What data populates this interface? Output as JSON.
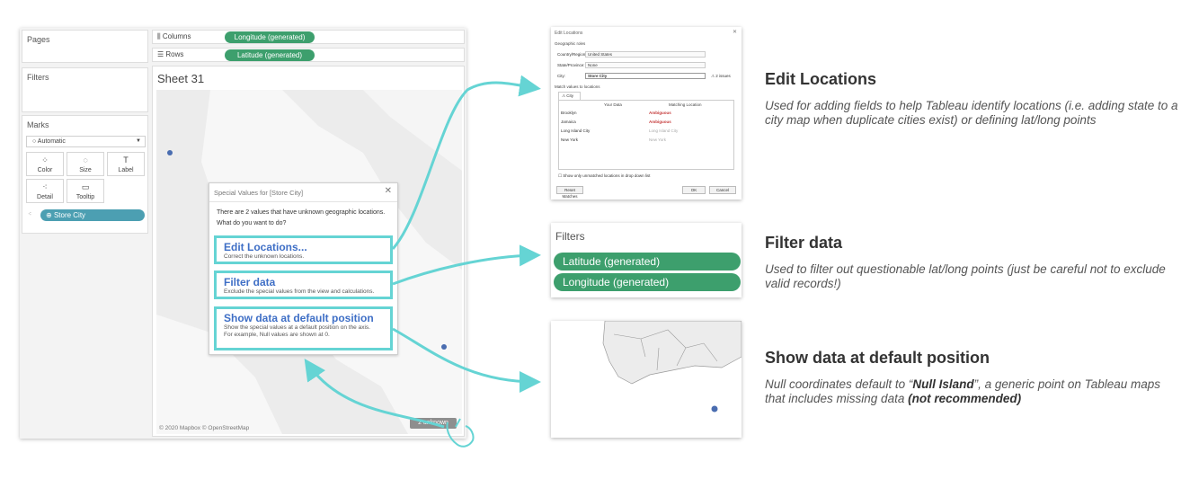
{
  "tableau": {
    "pages_label": "Pages",
    "filters_label": "Filters",
    "marks_label": "Marks",
    "mark_type": "Automatic",
    "mark_buttons": [
      {
        "icon": "color-icon",
        "glyph": "⁘",
        "label": "Color"
      },
      {
        "icon": "size-icon",
        "glyph": "◌",
        "label": "Size"
      },
      {
        "icon": "label-icon",
        "glyph": "T",
        "label": "Label"
      },
      {
        "icon": "detail-icon",
        "glyph": "⁖",
        "label": "Detail"
      },
      {
        "icon": "tooltip-icon",
        "glyph": "▭",
        "label": "Tooltip"
      }
    ],
    "marks_pill": "Store City",
    "columns_label": "Columns",
    "rows_label": "Rows",
    "columns_pill": "Longitude (generated)",
    "rows_pill": "Latitude (generated)",
    "sheet_title": "Sheet 31",
    "map_attribution": "© 2020 Mapbox © OpenStreetMap",
    "unknown_indicator": "2 unknown"
  },
  "dialog": {
    "title": "Special Values for [Store City]",
    "message1": "There are 2 values that have unknown geographic locations.",
    "message2": "What do you want to do?",
    "options": [
      {
        "title": "Edit Locations...",
        "desc": "Correct the unknown locations."
      },
      {
        "title": "Filter data",
        "desc": "Exclude the special values from the view and calculations."
      },
      {
        "title": "Show data at default position",
        "desc1": "Show the special values at a default position on the axis.",
        "desc2": "For example, Null values are shown at 0."
      }
    ]
  },
  "edit_locations_snapshot": {
    "title": "Edit Locations",
    "section_roles": "Geographic roles",
    "country_label": "Country/Region:",
    "country_value": "United States",
    "state_label": "State/Province:",
    "state_value": "None",
    "city_label": "City:",
    "city_value": "Store City",
    "issues": "⚠ 2 issues",
    "section_match": "Match values to locations",
    "tab": "⚠ City",
    "col_your_data": "Your Data",
    "col_matching": "Matching Location",
    "rows": [
      {
        "data": "Brooklyn",
        "match": "Ambiguous",
        "kind": "amb"
      },
      {
        "data": "Jamaica",
        "match": "Ambiguous",
        "kind": "amb"
      },
      {
        "data": "Long Island City",
        "match": "Long Island City",
        "kind": "grey"
      },
      {
        "data": "New York",
        "match": "New York",
        "kind": "grey"
      }
    ],
    "checkbox_label": "Show only unmatched locations in drop down list",
    "reset_button": "Reset Matches",
    "ok_button": "OK",
    "cancel_button": "Cancel"
  },
  "filters_snapshot": {
    "title": "Filters",
    "pills": [
      "Latitude (generated)",
      "Longitude (generated)"
    ]
  },
  "right_panel": {
    "sections": [
      {
        "title": "Edit Locations",
        "desc": "Used for adding fields to help Tableau identify locations (i.e. adding state to a city map when duplicate cities exist) or defining lat/long points"
      },
      {
        "title": "Filter data",
        "desc": "Used to filter out questionable lat/long points (just be careful not to exclude valid records!)"
      },
      {
        "title": "Show data at default position",
        "desc_pre": "Null coordinates default to “",
        "desc_bold": "Null Island",
        "desc_mid": "”, a generic point on Tableau maps that includes missing data ",
        "desc_bold2": "(not recommended)"
      }
    ]
  },
  "colors": {
    "accent_teal": "#65d4d4",
    "pill_green": "#3d9f6d",
    "pill_blue": "#4c9fb2",
    "link_blue": "#3f6fc6",
    "mark_dot": "#4a6db0"
  }
}
